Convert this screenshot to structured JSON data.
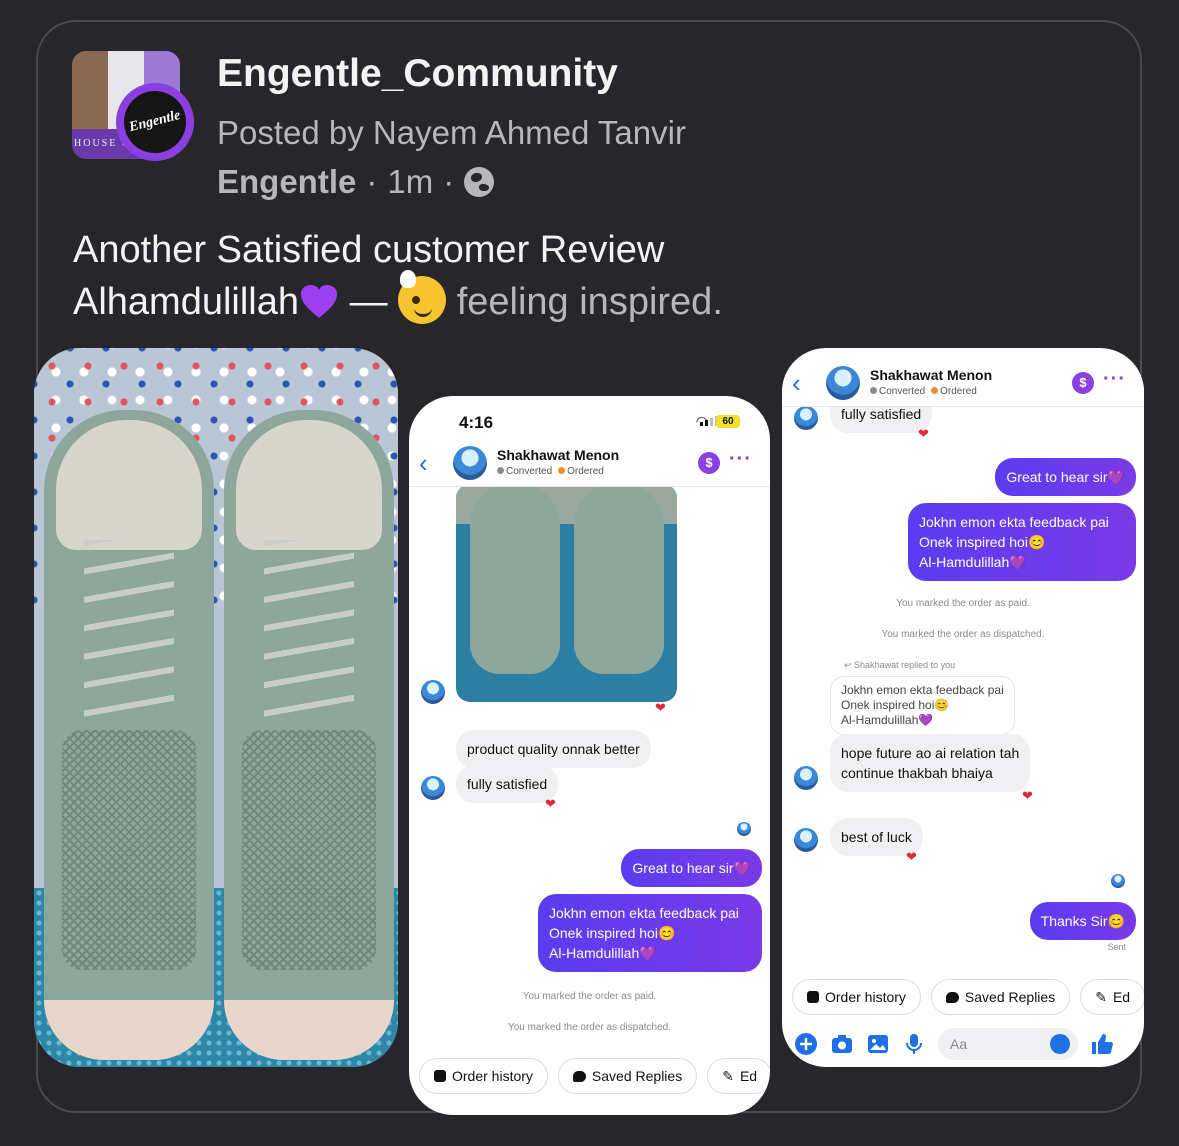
{
  "post": {
    "group_name": "Engentle_Community",
    "posted_by": "Posted by Nayem Ahmed Tanvir",
    "page_name": "Engentle",
    "separator": "·",
    "time": "1m",
    "privacy_icon": "globe-icon",
    "caption_line1": "Another Satisfied customer Review",
    "caption_line2": "Alhamdulillah",
    "dash": "—",
    "feeling": "feeling inspired.",
    "avatar_logo_text": "Engentle",
    "avatar_house_text": "HOUSE OF"
  },
  "colors": {
    "background": "#27272b",
    "accent_purple": "#8b3fe0",
    "outgoing_bubble": "#5a3cf0",
    "reaction_heart": "#e02a3a",
    "messenger_blue": "#1f6fe5"
  },
  "screenshot2": {
    "time": "4:16",
    "battery": "60",
    "contact_name": "Shakhawat Menon",
    "status_converted": "Converted",
    "status_ordered": "Ordered",
    "msg_quality": "product quality onnak better",
    "msg_satisfied": "fully satisfied",
    "msg_great": "Great to hear sir💜",
    "msg_feedback_1": "Jokhn emon ekta feedback pai",
    "msg_feedback_2": "Onek inspired hoi😊",
    "msg_feedback_3": "Al-Hamdulillah💜",
    "sys_paid": "You marked the order as paid.",
    "sys_dispatched": "You marked the order as dispatched.",
    "chip_order_history": "Order history",
    "chip_saved_replies": "Saved Replies",
    "chip_edit": "Ed",
    "reaction": "❤"
  },
  "screenshot3": {
    "contact_name": "Shakhawat Menon",
    "status_converted": "Converted",
    "status_ordered": "Ordered",
    "msg_satisfied": "fully satisfied",
    "msg_great": "Great to hear sir💜",
    "msg_feedback_1": "Jokhn emon ekta feedback pai",
    "msg_feedback_2": "Onek inspired hoi😊",
    "msg_feedback_3": "Al-Hamdulillah💜",
    "sys_paid": "You marked the order as paid.",
    "sys_dispatched": "You marked the order as dispatched.",
    "replied_label": "Shakhawat replied to you",
    "quote_1": "Jokhn emon ekta feedback pai",
    "quote_2": "Onek inspired hoi😊",
    "quote_3": "Al-Hamdulillah💜",
    "msg_future_1": "hope future ao ai relation tah",
    "msg_future_2": "continue thakbah bhaiya",
    "msg_luck": "best of luck",
    "msg_thanks": "Thanks Sir😊",
    "sent_label": "Sent",
    "chip_order_history": "Order history",
    "chip_saved_replies": "Saved Replies",
    "chip_edit": "Ed",
    "input_placeholder": "Aa",
    "reaction": "❤"
  }
}
